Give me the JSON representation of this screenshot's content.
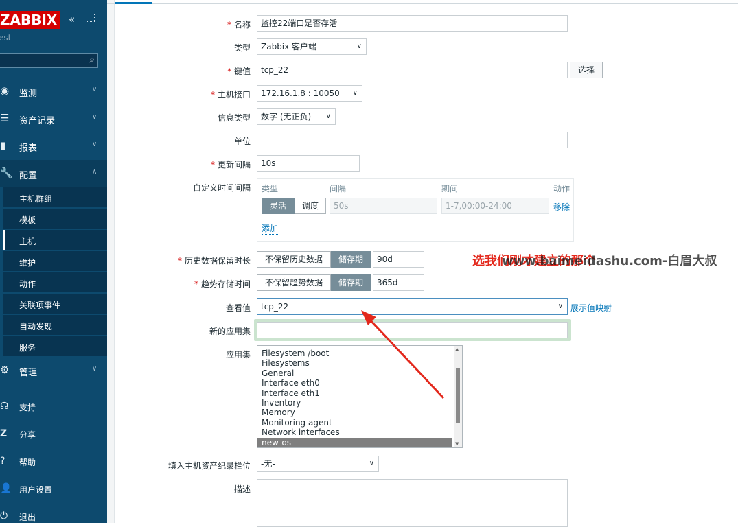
{
  "sidebar": {
    "logo": "ZABBIX",
    "server_name": "est",
    "collapse_icon": "double-chevron-left",
    "kiosk_icon": "fullscreen",
    "search_placeholder": "",
    "menu": [
      {
        "label": "监测",
        "icon": "eye-icon",
        "expanded": false
      },
      {
        "label": "资产记录",
        "icon": "list-icon",
        "expanded": false
      },
      {
        "label": "报表",
        "icon": "bar-chart-icon",
        "expanded": false
      },
      {
        "label": "配置",
        "icon": "wrench-icon",
        "expanded": true
      },
      {
        "label": "管理",
        "icon": "gear-icon",
        "expanded": false
      }
    ],
    "config_submenu": [
      "主机群组",
      "模板",
      "主机",
      "维护",
      "动作",
      "关联项事件",
      "自动发现",
      "服务"
    ],
    "config_selected": "主机",
    "bottom_items": [
      {
        "label": "支持",
        "icon": "headset-icon"
      },
      {
        "label": "分享",
        "icon": "share-icon"
      },
      {
        "label": "帮助",
        "icon": "help-icon"
      },
      {
        "label": "用户设置",
        "icon": "user-icon"
      },
      {
        "label": "退出",
        "icon": "power-icon"
      }
    ]
  },
  "form": {
    "name": {
      "label": "名称",
      "required": "*",
      "value": "监控22端口是否存活"
    },
    "type": {
      "label": "类型",
      "value": "Zabbix 客户端"
    },
    "key": {
      "label": "键值",
      "required": "*",
      "value": "tcp_22",
      "button": "选择"
    },
    "interface": {
      "label": "主机接口",
      "required": "*",
      "value": "172.16.1.8 : 10050"
    },
    "info_type": {
      "label": "信息类型",
      "value": "数字 (无正负)"
    },
    "units": {
      "label": "单位",
      "value": ""
    },
    "interval": {
      "label": "更新间隔",
      "required": "*",
      "value": "10s"
    },
    "custom_intervals": {
      "label": "自定义时间间隔",
      "headers": {
        "type": "类型",
        "interval": "间隔",
        "period": "期间",
        "action": "动作"
      },
      "row": {
        "type_flexible": "灵活",
        "type_scheduling": "调度",
        "interval_placeholder": "50s",
        "period_placeholder": "1-7,00:00-24:00",
        "remove": "移除"
      },
      "add": "添加"
    },
    "history": {
      "label": "历史数据保留时长",
      "required": "*",
      "opt_off": "不保留历史数据",
      "opt_on": "储存期",
      "value": "90d"
    },
    "trends": {
      "label": "趋势存储时间",
      "required": "*",
      "opt_off": "不保留趋势数据",
      "opt_on": "储存期",
      "value": "365d"
    },
    "valuemap": {
      "label": "查看值",
      "value": "tcp_22",
      "link": "展示值映射"
    },
    "new_app": {
      "label": "新的应用集",
      "value": ""
    },
    "applications": {
      "label": "应用集",
      "options": [
        "Filesystem /boot",
        "Filesystems",
        "General",
        "Interface eth0",
        "Interface eth1",
        "Inventory",
        "Memory",
        "Monitoring agent",
        "Network interfaces",
        "new-os"
      ],
      "selected": "new-os"
    },
    "inventory": {
      "label": "填入主机资产纪录栏位",
      "value": "-无-"
    },
    "description": {
      "label": "描述",
      "value": ""
    }
  },
  "annotation": {
    "text": "选我们刚才建立的那个",
    "watermark": "www.baimeidashu.com-白眉大叔",
    "color": "#e3281c"
  },
  "colors": {
    "sidebar": "#0d4a6e",
    "accent": "#0275b8",
    "logo_red": "#d40000",
    "toggle_on": "#768d99"
  }
}
